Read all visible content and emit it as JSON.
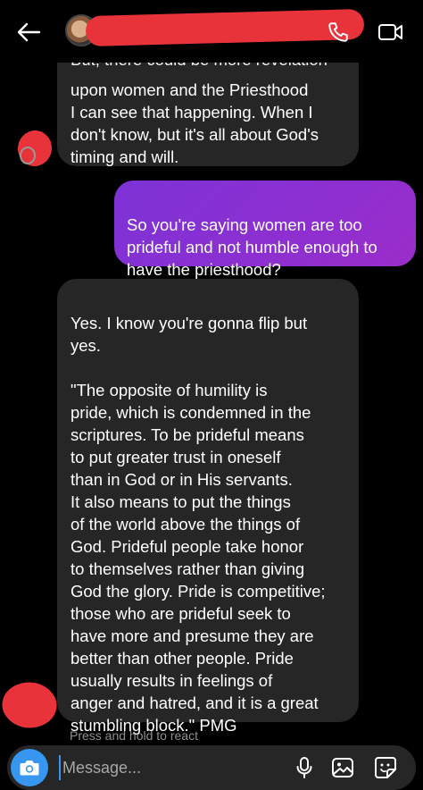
{
  "messages": [
    {
      "direction": "received",
      "top_text": "But, there could be more revelation",
      "text": "upon women and the Priesthood\nI can see that happening. When I\ndon't know, but it's all about God's\ntiming and will."
    },
    {
      "direction": "sent",
      "text": "So you're saying women are too\nprideful and not humble enough to\nhave the priesthood?"
    },
    {
      "direction": "received",
      "text": "Yes. I know you're gonna flip but\nyes.\n\n\"The opposite of humility is\npride, which is condemned in the\nscriptures. To be prideful means\nto put greater trust in oneself\nthan in God or in His servants.\nIt also means to put the things\nof the world above the things of\nGod. Prideful people take honor\nto themselves rather than giving\nGod the glory. Pride is competitive;\nthose who are prideful seek to\nhave more and presume they are\nbetter than other people. Pride\nusually results in feelings of\nanger and hatred, and it is a great\nstumbling block.\" PMG"
    }
  ],
  "hint": "Press and hold to react",
  "composer": {
    "placeholder": "Message..."
  },
  "icons": {
    "back": "arrow-left-icon",
    "call": "phone-icon",
    "video": "video-camera-icon",
    "camera": "camera-icon",
    "mic": "microphone-icon",
    "gallery": "image-icon",
    "sticker": "sticker-icon"
  },
  "colors": {
    "background": "#000000",
    "received_bubble": "#262626",
    "sent_bubble": "#8a30d3",
    "accent": "#3797f0",
    "redaction": "#e8333a"
  }
}
